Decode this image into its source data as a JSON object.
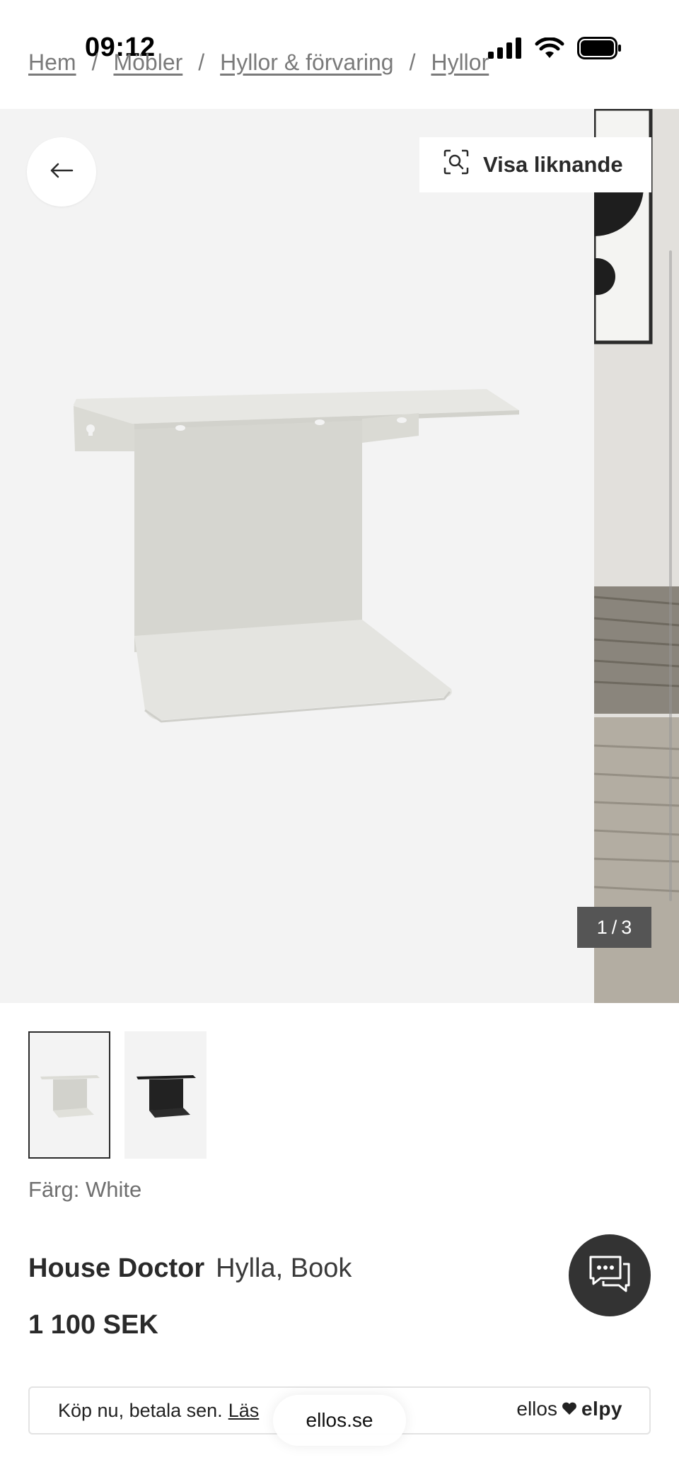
{
  "status_bar": {
    "time": "09:12"
  },
  "breadcrumb": [
    {
      "label": "Hem"
    },
    {
      "label": "Möbler"
    },
    {
      "label": "Hyllor & förvaring"
    },
    {
      "label": "Hyllor"
    }
  ],
  "breadcrumb_separator": "/",
  "gallery": {
    "similar_button_label": "Visa liknande",
    "counter": {
      "current": "1",
      "separator": "/",
      "total": "3"
    },
    "thumbnails": [
      {
        "variant": "White",
        "active": true
      },
      {
        "variant": "Black",
        "active": false
      }
    ]
  },
  "product": {
    "color_label": "Färg: White",
    "brand": "House Doctor",
    "name": "Hylla, Book",
    "price": "1 100 SEK"
  },
  "pay_later": {
    "text": "Köp nu, betala sen.",
    "link": "Läs",
    "logo_left": "ellos",
    "logo_right": "elpy"
  },
  "browser": {
    "url": "ellos.se"
  },
  "colors": {
    "text": "#2a2a2a",
    "chat_button": "#333333",
    "counter_bg": "#555555",
    "image_bg": "#f3f3f3"
  }
}
